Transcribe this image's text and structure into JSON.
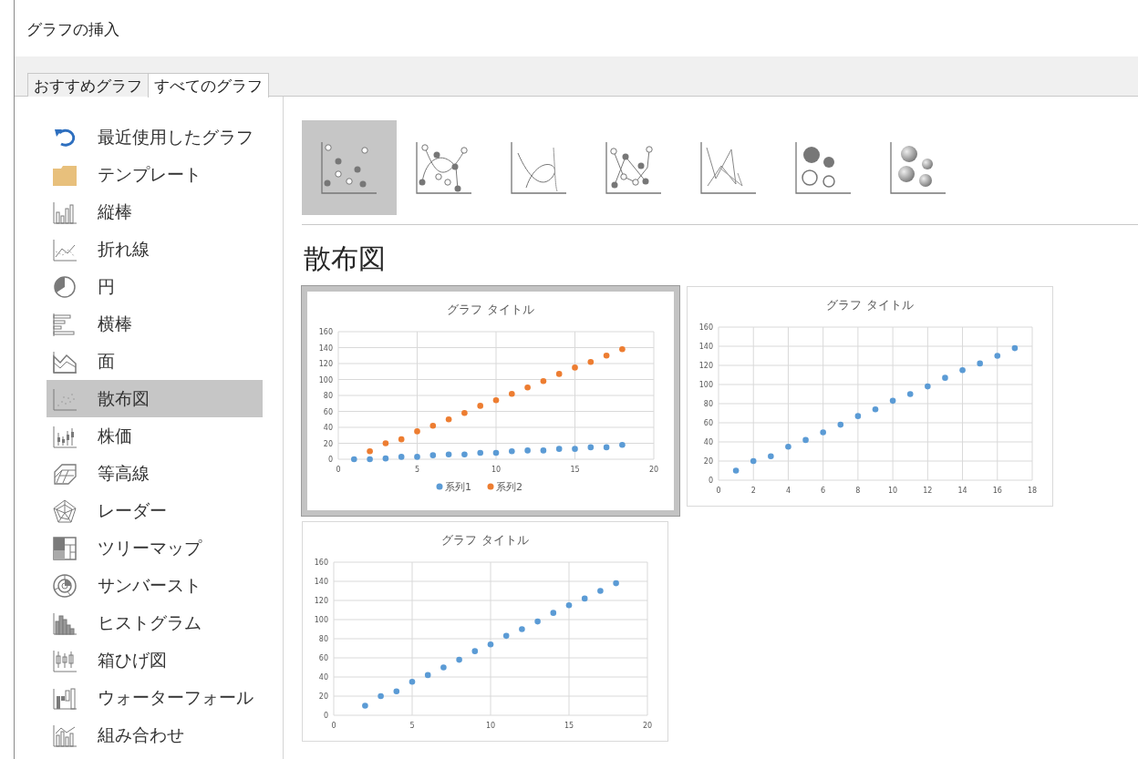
{
  "window": {
    "title": "グラフの挿入"
  },
  "tabs": [
    {
      "label": "おすすめグラフ",
      "selected": false
    },
    {
      "label": "すべてのグラフ",
      "selected": true
    }
  ],
  "sidebar": {
    "items": [
      {
        "label": "最近使用したグラフ",
        "selected": false
      },
      {
        "label": "テンプレート",
        "selected": false
      },
      {
        "label": "縦棒",
        "selected": false
      },
      {
        "label": "折れ線",
        "selected": false
      },
      {
        "label": "円",
        "selected": false
      },
      {
        "label": "横棒",
        "selected": false
      },
      {
        "label": "面",
        "selected": false
      },
      {
        "label": "散布図",
        "selected": true
      },
      {
        "label": "株価",
        "selected": false
      },
      {
        "label": "等高線",
        "selected": false
      },
      {
        "label": "レーダー",
        "selected": false
      },
      {
        "label": "ツリーマップ",
        "selected": false
      },
      {
        "label": "サンバースト",
        "selected": false
      },
      {
        "label": "ヒストグラム",
        "selected": false
      },
      {
        "label": "箱ひげ図",
        "selected": false
      },
      {
        "label": "ウォーターフォール",
        "selected": false
      },
      {
        "label": "組み合わせ",
        "selected": false
      }
    ]
  },
  "subtypes": [
    {
      "selected": true
    },
    {
      "selected": false
    },
    {
      "selected": false
    },
    {
      "selected": false
    },
    {
      "selected": false
    },
    {
      "selected": false
    },
    {
      "selected": false
    }
  ],
  "heading": "散布図",
  "previews": [
    {
      "selected": true,
      "chart_data": {
        "type": "scatter",
        "title": "グラフ タイトル",
        "grid": true,
        "legend": true,
        "x": [
          1,
          2,
          3,
          4,
          5,
          6,
          7,
          8,
          9,
          10,
          11,
          12,
          13,
          14,
          15,
          16,
          17,
          18
        ],
        "xlim": [
          0,
          20
        ],
        "ylim": [
          0,
          160
        ],
        "xticks": [
          0,
          5,
          10,
          15,
          20
        ],
        "yticks": [
          0,
          20,
          40,
          60,
          80,
          100,
          120,
          140,
          160
        ],
        "series": [
          {
            "name": "系列1",
            "color": "#5b9bd5",
            "values": [
              0,
              0,
              1,
              3,
              3,
              5,
              6,
              6,
              8,
              8,
              10,
              11,
              11,
              13,
              13,
              15,
              15,
              18
            ]
          },
          {
            "name": "系列2",
            "color": "#ed7d31",
            "values": [
              null,
              10,
              20,
              25,
              35,
              42,
              50,
              58,
              67,
              74,
              82,
              90,
              98,
              107,
              115,
              122,
              130,
              138
            ]
          }
        ]
      }
    },
    {
      "selected": false,
      "chart_data": {
        "type": "scatter",
        "title": "グラフ タイトル",
        "grid": true,
        "x": [
          1,
          2,
          3,
          4,
          5,
          6,
          7,
          8,
          9,
          10,
          11,
          12,
          13,
          14,
          15,
          16,
          17
        ],
        "xlim": [
          0,
          18
        ],
        "ylim": [
          0,
          160
        ],
        "xticks": [
          0,
          2,
          4,
          6,
          8,
          10,
          12,
          14,
          16,
          18
        ],
        "yticks": [
          0,
          20,
          40,
          60,
          80,
          100,
          120,
          140,
          160
        ],
        "series": [
          {
            "color": "#5b9bd5",
            "values": [
              10,
              20,
              25,
              35,
              42,
              50,
              58,
              67,
              74,
              83,
              90,
              98,
              107,
              115,
              122,
              130,
              138
            ]
          }
        ]
      }
    },
    {
      "selected": false,
      "chart_data": {
        "type": "scatter",
        "title": "グラフ タイトル",
        "grid": true,
        "x": [
          2,
          3,
          4,
          5,
          6,
          7,
          8,
          9,
          10,
          11,
          12,
          13,
          14,
          15,
          16,
          17,
          18
        ],
        "xlim": [
          0,
          20
        ],
        "ylim": [
          0,
          160
        ],
        "xticks": [
          0,
          5,
          10,
          15,
          20
        ],
        "yticks": [
          0,
          20,
          40,
          60,
          80,
          100,
          120,
          140,
          160
        ],
        "series": [
          {
            "color": "#5b9bd5",
            "values": [
              10,
              20,
              25,
              35,
              42,
              50,
              58,
              67,
              74,
              83,
              90,
              98,
              107,
              115,
              122,
              130,
              138
            ]
          }
        ]
      }
    }
  ]
}
